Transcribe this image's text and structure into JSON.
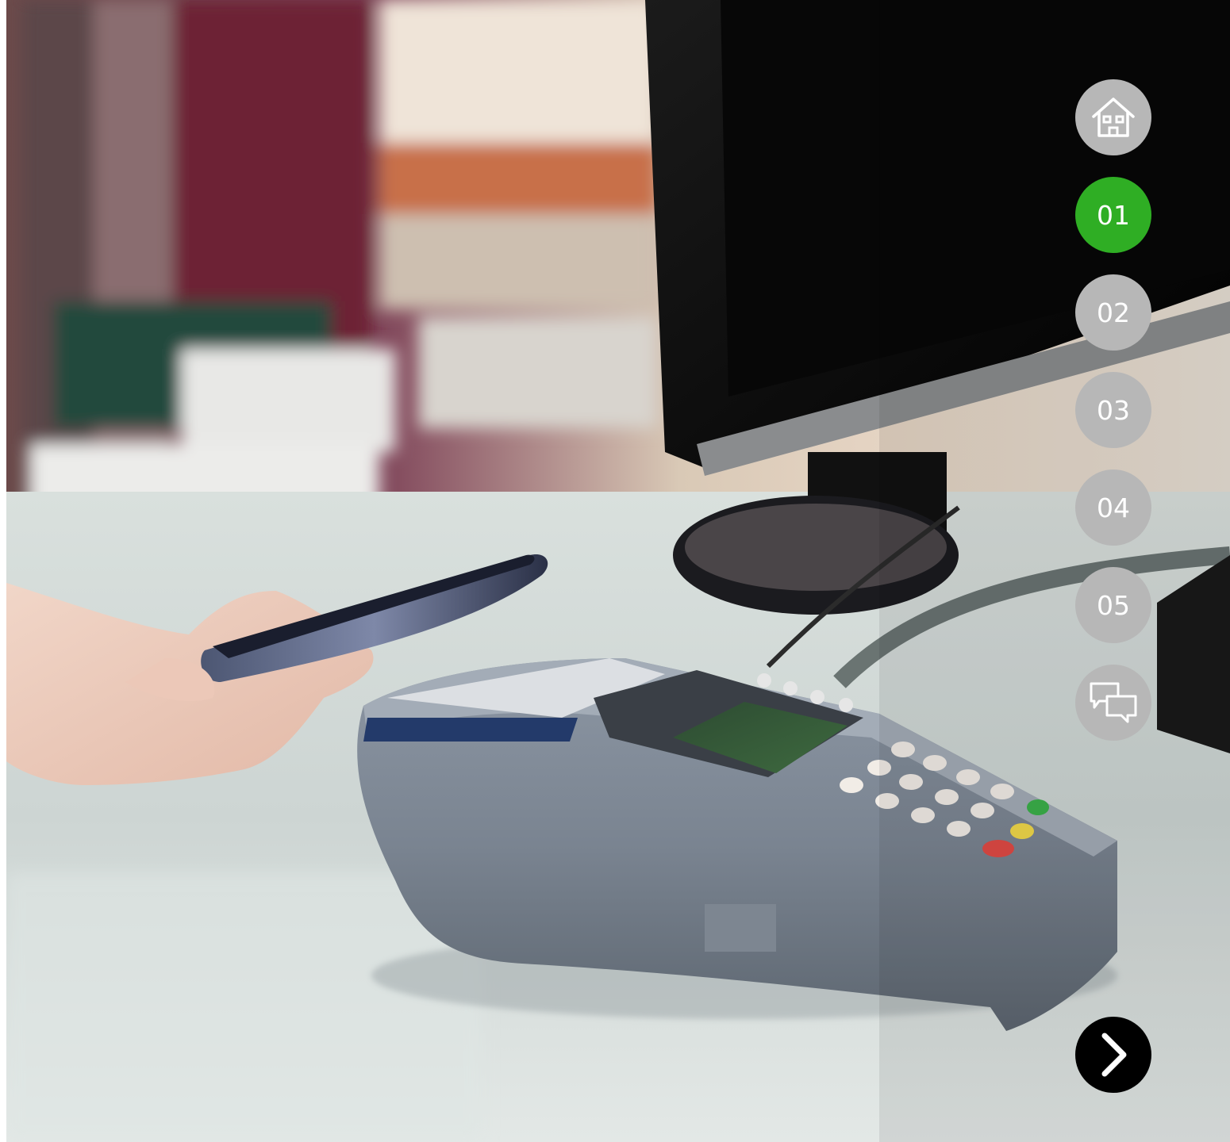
{
  "scene": {
    "description_icon": "photo-contactless-payment"
  },
  "nav": {
    "home_icon": "home-icon",
    "items": [
      {
        "label": "01",
        "active": true
      },
      {
        "label": "02",
        "active": false
      },
      {
        "label": "03",
        "active": false
      },
      {
        "label": "04",
        "active": false
      },
      {
        "label": "05",
        "active": false
      }
    ],
    "chat_icon": "chat-bubbles-icon",
    "next_icon": "chevron-right-icon"
  },
  "colors": {
    "active": "#2fae24",
    "inactive": "#b7b7b7",
    "next": "#000000"
  }
}
